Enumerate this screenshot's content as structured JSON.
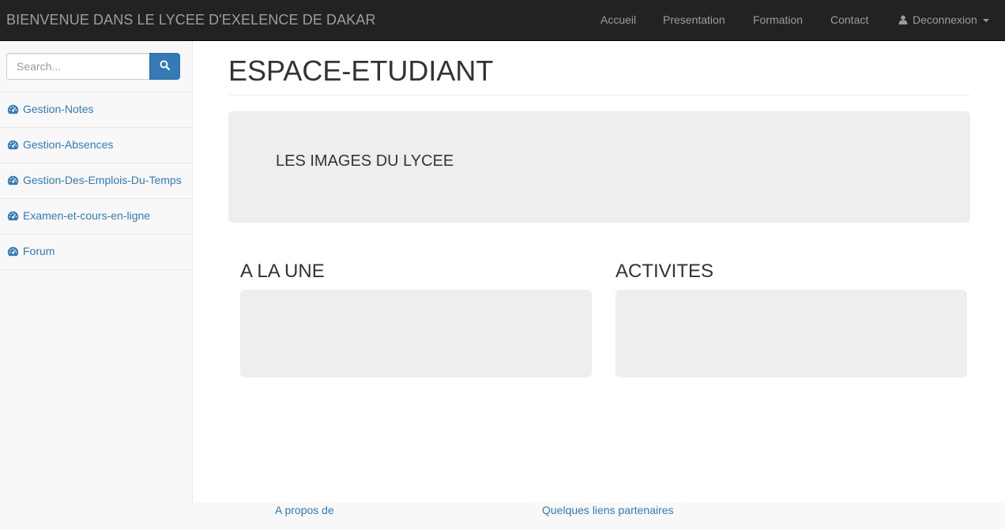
{
  "navbar": {
    "brand": "BIENVENUE DANS LE LYCEE D'EXELENCE DE DAKAR",
    "links": [
      "Accueil",
      "Presentation",
      "Formation",
      "Contact"
    ],
    "user_menu": "Deconnexion"
  },
  "sidebar": {
    "search_placeholder": "Search...",
    "items": [
      "Gestion-Notes",
      "Gestion-Absences",
      "Gestion-Des-Emplois-Du-Temps",
      "Examen-et-cours-en-ligne",
      "Forum"
    ]
  },
  "main": {
    "page_title": "ESPACE-ETUDIANT",
    "jumbotron_text": "LES IMAGES DU LYCEE",
    "columns": [
      "A LA UNE",
      "ACTIVITES"
    ]
  },
  "footer": {
    "links": [
      "A propos de",
      "Quelques liens partenaires"
    ]
  },
  "colors": {
    "navbar_bg": "#222222",
    "link": "#337ab7",
    "panel_bg": "#eeeeee",
    "sidebar_bg": "#f8f8f8"
  },
  "icons": {
    "search": "search-icon",
    "user": "user-icon",
    "caret": "caret-down-icon",
    "menu": "dashboard-icon"
  }
}
